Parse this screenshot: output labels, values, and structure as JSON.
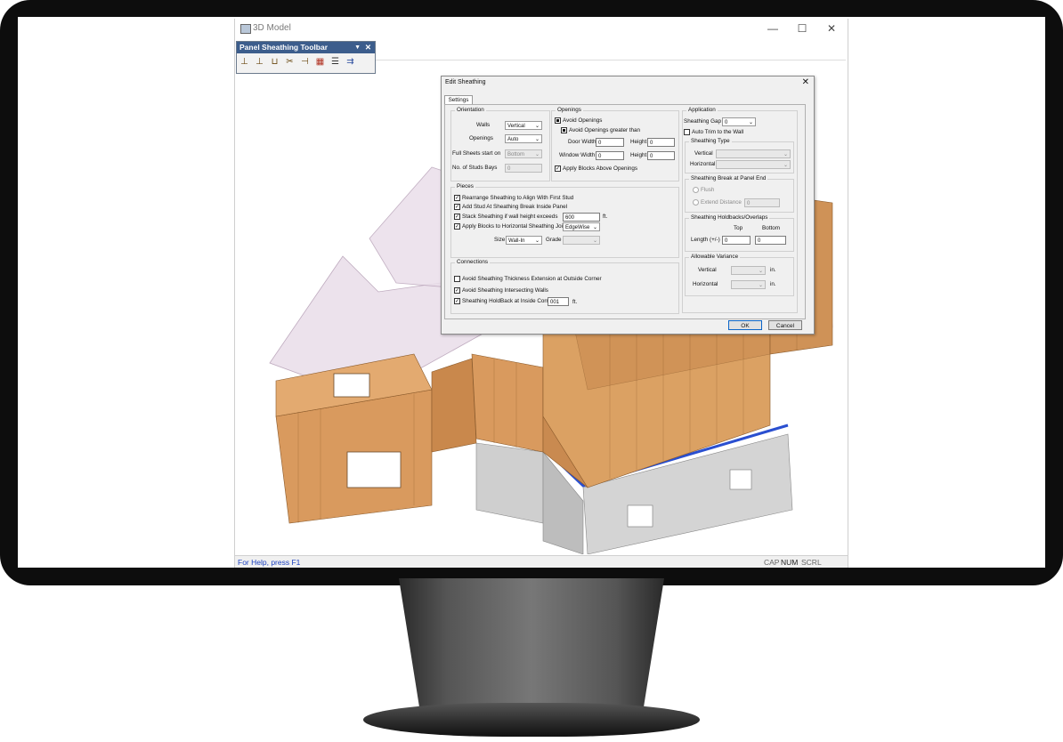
{
  "window": {
    "title": "3D Model",
    "minimize": "—",
    "maximize": "☐",
    "close": "✕"
  },
  "statusbar": {
    "help": "For Help, press F1",
    "cap": "CAP",
    "num": "NUM",
    "scrl": "SCRL"
  },
  "toolbar": {
    "title": "Panel Sheathing Toolbar",
    "close": "✕",
    "dropdown": "▼",
    "icons": [
      "add-sheathing-icon",
      "add-piece-icon",
      "split-icon",
      "trim-icon",
      "move-icon",
      "sheathing-edit-icon",
      "layers-icon",
      "export-icon"
    ]
  },
  "dialog": {
    "title": "Edit Sheathing",
    "close": "✕",
    "tab": "Settings",
    "orientation": {
      "label": "Orientation",
      "walls_label": "Walls",
      "walls_value": "Vertical",
      "openings_label": "Openings",
      "openings_value": "Auto",
      "full_sheets_label": "Full Sheets start on",
      "full_sheets_value": "Bottom",
      "studs_bays_label": "No. of Studs Bays",
      "studs_bays_value": "0"
    },
    "openings": {
      "label": "Openings",
      "avoid_openings": "Avoid Openings",
      "avoid_greater": "Avoid Openings greater than",
      "door_width_label": "Door Width",
      "door_width": "0",
      "door_height_label": "Height",
      "door_height": "0",
      "window_width_label": "Window Width",
      "window_width": "0",
      "window_height_label": "Height",
      "window_height": "0",
      "apply_blocks_above": "Apply Blocks Above Openings"
    },
    "pieces": {
      "label": "Pieces",
      "rearrange": "Rearrange Sheathing to Align With First Stud",
      "add_stud": "Add Stud At Sheathing Break Inside Panel",
      "stack": "Stack Sheathing if wall height exceeds",
      "stack_value": "600",
      "stack_unit": "ft.",
      "apply_blocks": "Apply Blocks to Horizontal Sheathing Joints",
      "apply_blocks_value": "EdgeWise",
      "size_label": "Size",
      "size_value": "Wall-In",
      "grade_label": "Grade",
      "grade_value": ""
    },
    "connections": {
      "label": "Connections",
      "avoid_thickness": "Avoid Sheathing Thickness Extension at Outside Corner",
      "avoid_intersecting": "Avoid Sheathing Intersecting Walls",
      "holdback": "Sheathing HoldBack at Inside Corner",
      "holdback_value": "001",
      "holdback_unit": "ft."
    },
    "application": {
      "label": "Application",
      "gap_label": "Sheathing Gap",
      "gap_value": "0",
      "auto_trim": "Auto Trim to the Wall",
      "type_label": "Sheathing Type",
      "vertical_label": "Vertical",
      "vertical_value": "",
      "horizontal_label": "Horizontal",
      "horizontal_value": "",
      "break_label": "Sheathing Break at Panel End",
      "flush": "Flush",
      "extend_label": "Extend Distance",
      "extend_value": "0",
      "holdbacks_label": "Sheathing Holdbacks/Overlaps",
      "top_label": "Top",
      "bottom_label": "Bottom",
      "length_label": "Length (+/-)",
      "length_top": "0",
      "length_bottom": "0",
      "variance_label": "Allowable Variance",
      "var_vertical_label": "Vertical",
      "var_vertical_value": "",
      "var_vertical_unit": "in.",
      "var_horizontal_label": "Horizontal",
      "var_horizontal_value": "",
      "var_horizontal_unit": "in."
    },
    "ok": "OK",
    "cancel": "Cancel"
  },
  "colors": {
    "wood": "#d99a5e",
    "wood_dark": "#b87a43",
    "roof": "#e8dbe8",
    "concrete": "#c9c9c9",
    "blue_sill": "#2a4fd0",
    "toolbar_title": "#3c5d8c"
  }
}
